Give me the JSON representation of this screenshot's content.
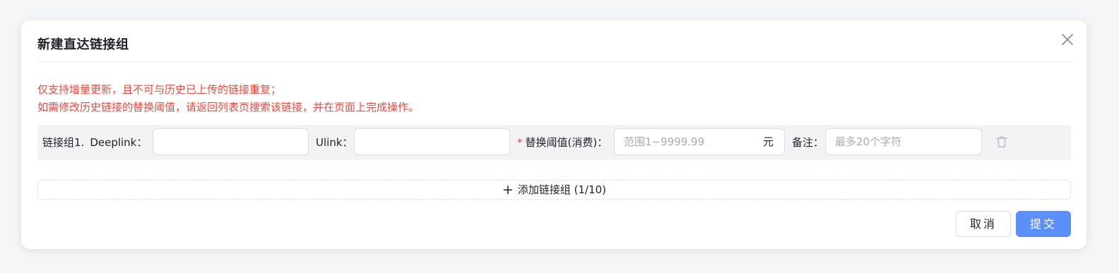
{
  "modal": {
    "title": "新建直达链接组",
    "notice_lines": [
      "仅支持增量更新，且不可与历史已上传的链接重复；",
      "如需修改历史链接的替换阈值，请返回列表页搜索该链接，并在页面上完成操作。"
    ]
  },
  "link_group": {
    "label": "链接组1.",
    "deeplink_label": "Deeplink：",
    "deeplink_value": "",
    "ulink_label": "Ulink：",
    "ulink_value": "",
    "required_mark": "*",
    "threshold_label": "替换阈值(消费)：",
    "threshold_placeholder": "范围1~9999.99",
    "threshold_unit": "元",
    "remark_label": "备注：",
    "remark_placeholder": "最多20个字符"
  },
  "add_group": {
    "label": "添加链接组 (1/10)"
  },
  "footer": {
    "cancel_label": "取消",
    "submit_label": "提交"
  },
  "colors": {
    "accent": "#5b8ff9",
    "warning": "#f0483e",
    "row_bg": "#f2f3f5"
  },
  "icons": {
    "close": "close-icon",
    "delete": "trash-icon",
    "add": "plus-icon"
  }
}
